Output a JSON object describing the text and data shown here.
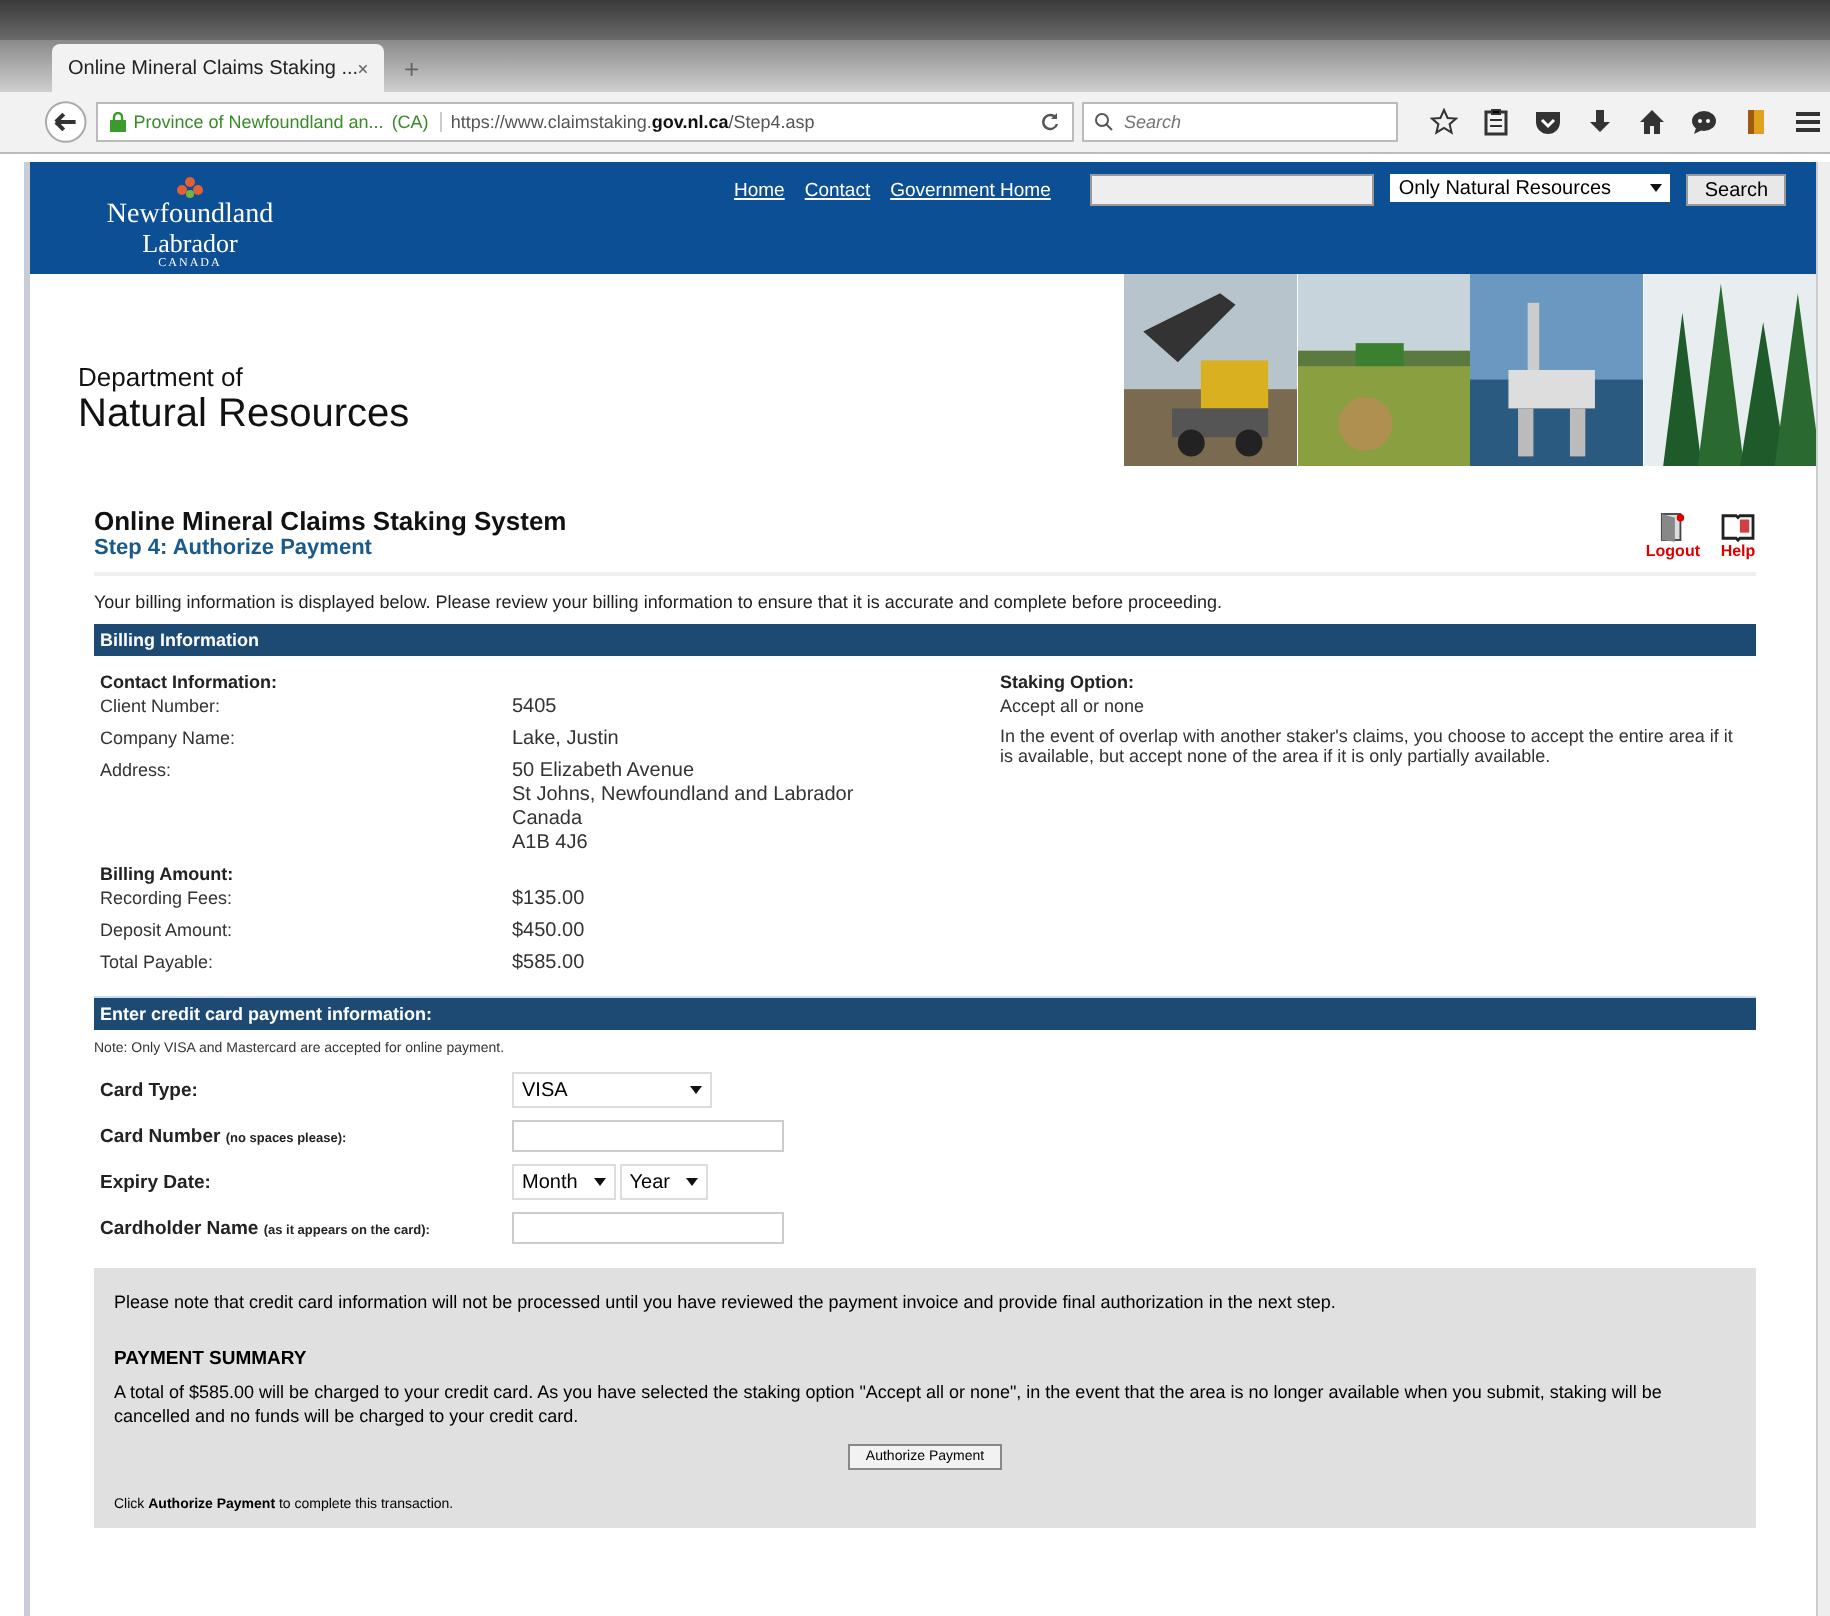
{
  "browser": {
    "tab_title": "Online Mineral Claims Staking ...",
    "new_tab": "+",
    "site_identity": "Province of Newfoundland an...",
    "country": "(CA)",
    "url": "https://www.claimstaking.**gov.nl.ca**/Step4.asp",
    "search_placeholder": "Search"
  },
  "header": {
    "logo_lines": [
      "Newfoundland",
      "Labrador",
      "CANADA"
    ],
    "links": [
      "Home",
      "Contact",
      "Government Home"
    ],
    "scope": "Only Natural Resources",
    "search_button": "Search",
    "department": [
      "Department of",
      "Natural Resources"
    ]
  },
  "page": {
    "title": "Online Mineral Claims Staking System",
    "step": "Step 4: Authorize Payment",
    "actions": [
      {
        "kind": "logout",
        "label": "Logout"
      },
      {
        "kind": "help",
        "label": "Help"
      }
    ],
    "intro": "Your billing information is displayed below. Please review your billing information to ensure that it is accurate and complete before proceeding."
  },
  "billing": {
    "heading": "Billing Information",
    "contact_heading": "Contact Information:",
    "contact_rows": [
      {
        "label": "Client Number:",
        "value": [
          "5405"
        ]
      },
      {
        "label": "Company Name:",
        "value": [
          "Lake, Justin"
        ]
      },
      {
        "label": "Address:",
        "value": [
          "50 Elizabeth Avenue",
          "St Johns, Newfoundland and Labrador",
          "Canada",
          "A1B 4J6"
        ]
      }
    ],
    "amount_heading": "Billing Amount:",
    "amount_rows": [
      {
        "label": "Recording Fees:",
        "value": [
          "$135.00"
        ]
      },
      {
        "label": "Deposit Amount:",
        "value": [
          "$450.00"
        ]
      },
      {
        "label": "Total Payable:",
        "value": [
          "$585.00"
        ]
      }
    ],
    "staking_heading": "Staking Option:",
    "staking_value": "Accept all or none",
    "staking_description": "In the event of overlap with another staker's claims, you choose to accept the entire area if it is available, but accept none of the area if it is only partially available."
  },
  "payment": {
    "heading": "Enter credit card payment information:",
    "note": "Note: Only VISA and Mastercard are accepted for online payment.",
    "fields": [
      {
        "kind": "select",
        "label": "Card Type:",
        "values": [
          "VISA"
        ]
      },
      {
        "kind": "text",
        "label": "Card Number",
        "hint": "(no spaces please):"
      },
      {
        "kind": "selects",
        "label": "Expiry Date:",
        "values": [
          "Month",
          "Year"
        ]
      },
      {
        "kind": "text",
        "label": "Cardholder Name",
        "hint": "(as it appears on the card):"
      }
    ]
  },
  "summary": {
    "notice": "Please note that credit card information will not be processed until you have reviewed the payment invoice and provide final authorization in the next step.",
    "heading": "PAYMENT SUMMARY",
    "text": "A total of $585.00 will be charged to your credit card. As you have selected the staking option \"Accept all or none\", in the event that the area is no longer available when you submit, staking will be cancelled and no funds will be charged to your credit card.",
    "button": "Authorize Payment",
    "footer": "Click **Authorize Payment** to complete this transaction."
  }
}
